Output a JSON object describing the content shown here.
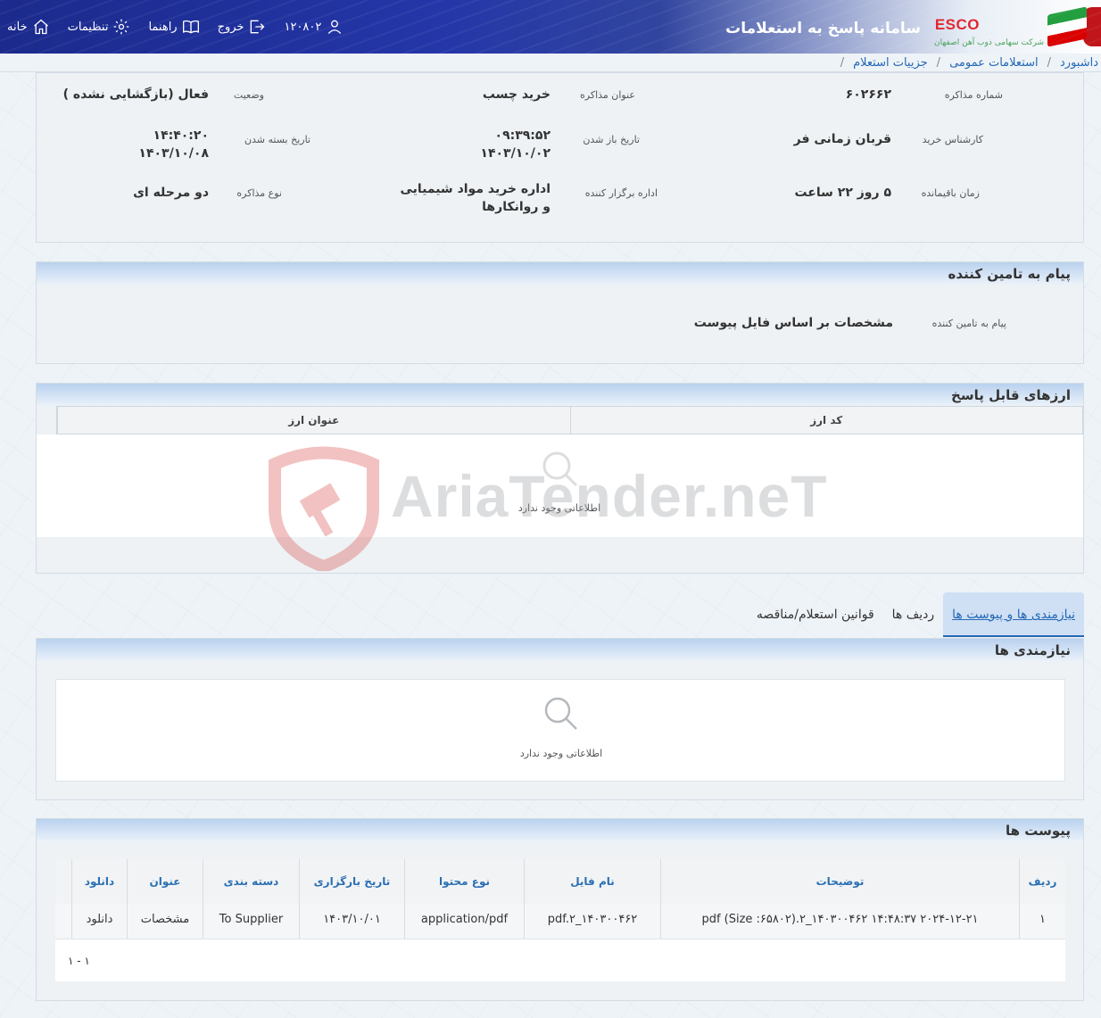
{
  "header": {
    "system_title": "سامانه پاسخ به استعلامات",
    "brand": "ESCO",
    "company": "شرکت سهامی ذوب آهن اصفهان",
    "nav": {
      "home": "خانه",
      "settings": "تنظیمات",
      "guide": "راهنما",
      "logout": "خروج",
      "user_id": "۱۲۰۸۰۲"
    }
  },
  "breadcrumb": [
    "داشبورد",
    "استعلامات عمومی",
    "جزییات استعلام"
  ],
  "info": {
    "negotiation_number_label": "شماره مذاکره",
    "negotiation_number": "۶۰۲۶۶۲",
    "title_label": "عنوان مذاکره",
    "title": "خرید چسب",
    "status_label": "وضعیت",
    "status": "فعال (بازگشایی نشده )",
    "expert_label": "کارشناس خرید",
    "expert": "قربان زمانی فر",
    "open_date_label": "تاریخ باز شدن",
    "open_time": "۰۹:۳۹:۵۲",
    "open_date": "۱۴۰۳/۱۰/۰۲",
    "close_date_label": "تاریخ بسته شدن",
    "close_time": "۱۴:۴۰:۲۰",
    "close_date": "۱۴۰۳/۱۰/۰۸",
    "remaining_label": "زمان باقیمانده",
    "remaining": "۵ روز ۲۲ ساعت",
    "organizer_label": "اداره برگزار کننده",
    "organizer": "اداره خرید مواد شیمیایی و روانکارها",
    "type_label": "نوع مذاکره",
    "type": "دو مرحله ای"
  },
  "supplier_message": {
    "header": "پیام به تامین کننده",
    "label": "پیام به تامین کننده",
    "value": "مشخصات بر اساس فایل پیوست"
  },
  "currencies": {
    "header": "ارزهای قابل پاسخ",
    "columns": [
      "کد ارز",
      "عنوان ارز"
    ],
    "empty": "اطلاعاتی وجود ندارد"
  },
  "tabs": [
    "نیازمندی ها و پیوست ها",
    "ردیف ها",
    "قوانین استعلام/مناقصه"
  ],
  "requirements": {
    "header": "نیازمندی ها",
    "empty": "اطلاعاتی وجود ندارد"
  },
  "attachments": {
    "header": "پیوست ها",
    "columns": [
      "ردیف",
      "توضیحات",
      "نام فایل",
      "نوع محتوا",
      "تاریخ بارگزاری",
      "دسته بندی",
      "عنوان",
      "دانلود"
    ],
    "rows": [
      {
        "row": "۱",
        "description": "pdf (Size :۶۵۸۰۲).۲_۱۴۰۳۰۰۴۶۲ ۱۴:۴۸:۳۷ ۲۰۲۴-۱۲-۲۱",
        "file_name": "pdf.۲_۱۴۰۳۰۰۴۶۲",
        "content_type": "application/pdf",
        "upload_date": "۱۴۰۳/۱۰/۰۱",
        "category": "To Supplier",
        "title": "مشخصات",
        "download": "دانلود"
      }
    ],
    "pagination": "۱ - ۱"
  },
  "watermark": "AriaTender.neT"
}
